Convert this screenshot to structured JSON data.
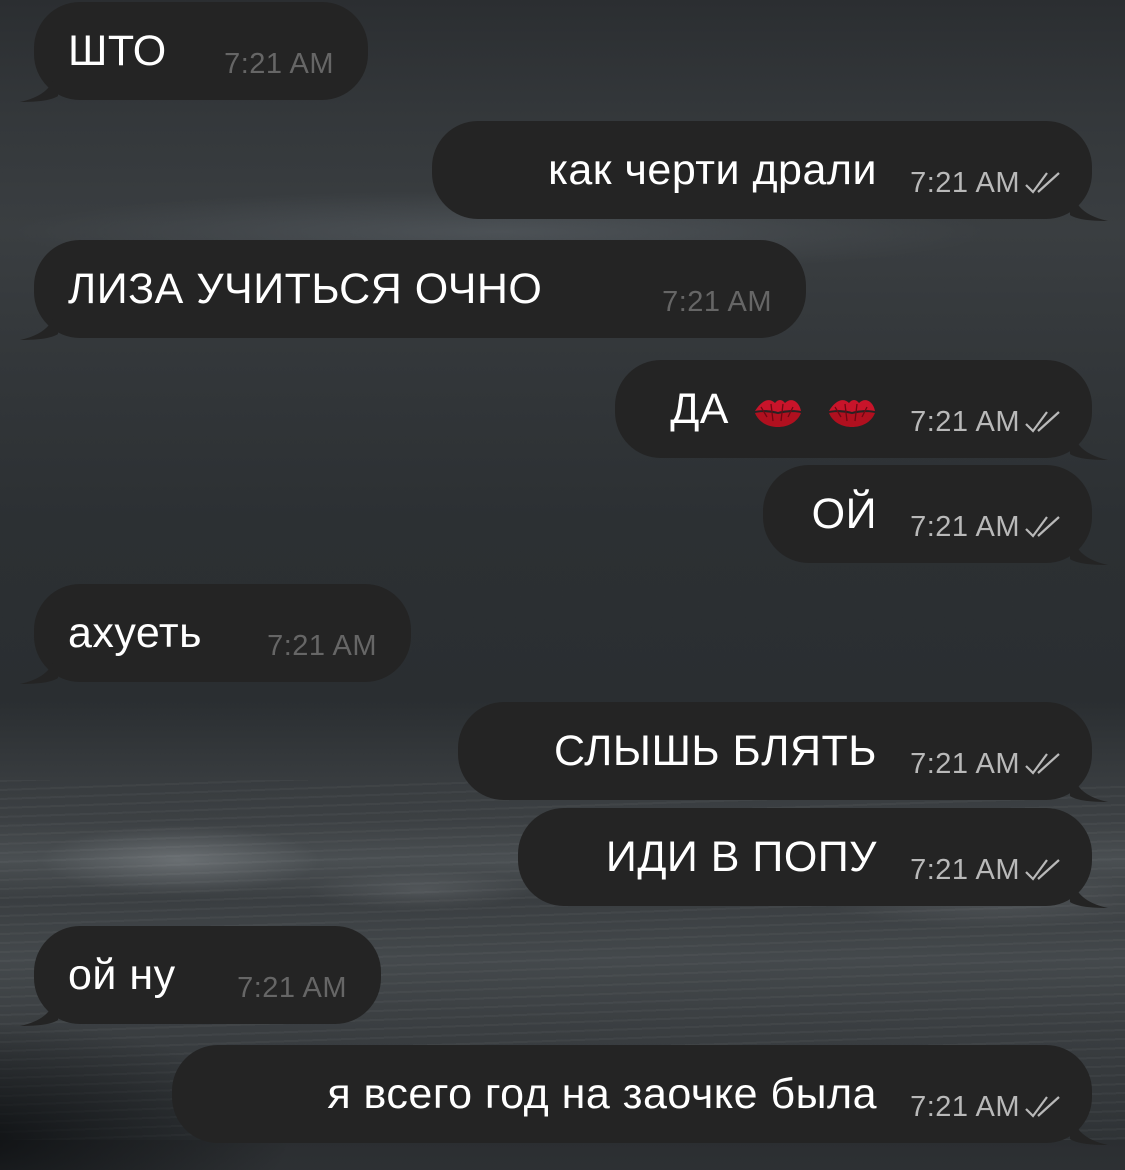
{
  "messages": [
    {
      "direction": "incoming",
      "text": "ШТО",
      "time": "7:21 AM"
    },
    {
      "direction": "outgoing",
      "text": "как черти драли",
      "time": "7:21 AM",
      "status": "read"
    },
    {
      "direction": "incoming",
      "text": "ЛИЗА УЧИТЬСЯ ОЧНО",
      "time": "7:21 AM"
    },
    {
      "direction": "outgoing",
      "text": "ДА",
      "emoji": [
        "kiss-mark-icon",
        "kiss-mark-icon"
      ],
      "time": "7:21 AM",
      "status": "read"
    },
    {
      "direction": "outgoing",
      "text": "ОЙ",
      "time": "7:21 AM",
      "status": "read"
    },
    {
      "direction": "incoming",
      "text": "ахуеть",
      "time": "7:21 AM"
    },
    {
      "direction": "outgoing",
      "text": "СЛЫШЬ БЛЯТЬ",
      "time": "7:21 AM",
      "status": "read"
    },
    {
      "direction": "outgoing",
      "text": "ИДИ В ПОПУ",
      "time": "7:21 AM",
      "status": "read"
    },
    {
      "direction": "incoming",
      "text": "ой ну",
      "time": "7:21 AM"
    },
    {
      "direction": "outgoing",
      "text": "я всего год на заочке была",
      "time": "7:21 AM",
      "status": "read"
    }
  ],
  "colors": {
    "bubble": "#242424",
    "text": "#ffffff",
    "time_incoming": "#666666",
    "time_outgoing": "#b9b9b9",
    "lips": "#c8142a"
  }
}
